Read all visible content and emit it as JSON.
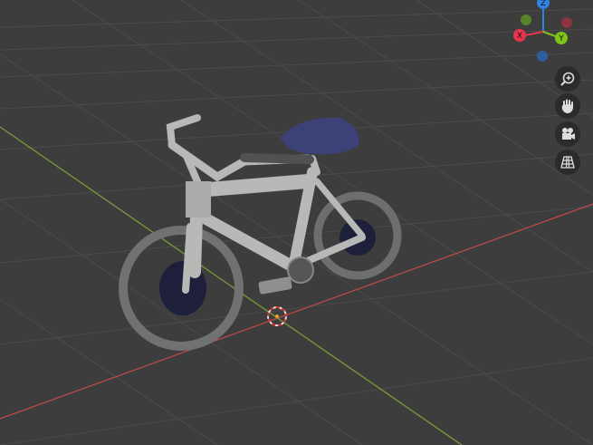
{
  "gizmo": {
    "x_label": "X",
    "y_label": "Y",
    "z_label": "Z",
    "colors": {
      "x": "#e8344c",
      "y": "#7ec418",
      "z": "#2f84e3",
      "neg_x": "#8b3640",
      "neg_y": "#58842c",
      "neg_z": "#2e5ea0"
    }
  },
  "nav_buttons": [
    {
      "icon": "zoom-icon"
    },
    {
      "icon": "hand-pan-icon"
    },
    {
      "icon": "camera-icon"
    },
    {
      "icon": "grid-perspective-icon"
    }
  ],
  "scene": {
    "object": "bicycle",
    "x_axis_color": "#b84a4a",
    "y_axis_color": "#7a9a3a",
    "grid_color": "#4a4a4a"
  }
}
